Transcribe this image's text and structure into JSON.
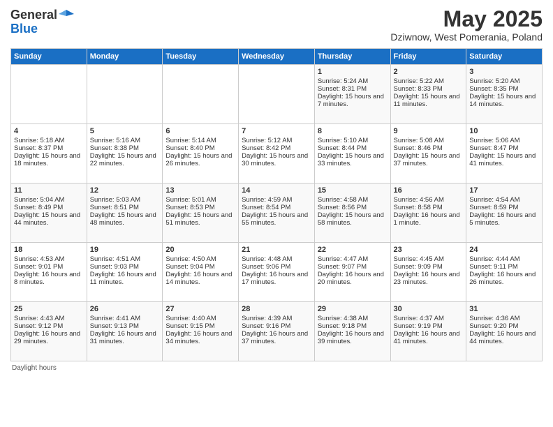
{
  "header": {
    "logo_general": "General",
    "logo_blue": "Blue",
    "month": "May 2025",
    "location": "Dziwnow, West Pomerania, Poland"
  },
  "days_of_week": [
    "Sunday",
    "Monday",
    "Tuesday",
    "Wednesday",
    "Thursday",
    "Friday",
    "Saturday"
  ],
  "footer": "Daylight hours",
  "weeks": [
    [
      {
        "day": "",
        "sunrise": "",
        "sunset": "",
        "daylight": "",
        "empty": true
      },
      {
        "day": "",
        "sunrise": "",
        "sunset": "",
        "daylight": "",
        "empty": true
      },
      {
        "day": "",
        "sunrise": "",
        "sunset": "",
        "daylight": "",
        "empty": true
      },
      {
        "day": "",
        "sunrise": "",
        "sunset": "",
        "daylight": "",
        "empty": true
      },
      {
        "day": "1",
        "sunrise": "Sunrise: 5:24 AM",
        "sunset": "Sunset: 8:31 PM",
        "daylight": "Daylight: 15 hours and 7 minutes."
      },
      {
        "day": "2",
        "sunrise": "Sunrise: 5:22 AM",
        "sunset": "Sunset: 8:33 PM",
        "daylight": "Daylight: 15 hours and 11 minutes."
      },
      {
        "day": "3",
        "sunrise": "Sunrise: 5:20 AM",
        "sunset": "Sunset: 8:35 PM",
        "daylight": "Daylight: 15 hours and 14 minutes."
      }
    ],
    [
      {
        "day": "4",
        "sunrise": "Sunrise: 5:18 AM",
        "sunset": "Sunset: 8:37 PM",
        "daylight": "Daylight: 15 hours and 18 minutes."
      },
      {
        "day": "5",
        "sunrise": "Sunrise: 5:16 AM",
        "sunset": "Sunset: 8:38 PM",
        "daylight": "Daylight: 15 hours and 22 minutes."
      },
      {
        "day": "6",
        "sunrise": "Sunrise: 5:14 AM",
        "sunset": "Sunset: 8:40 PM",
        "daylight": "Daylight: 15 hours and 26 minutes."
      },
      {
        "day": "7",
        "sunrise": "Sunrise: 5:12 AM",
        "sunset": "Sunset: 8:42 PM",
        "daylight": "Daylight: 15 hours and 30 minutes."
      },
      {
        "day": "8",
        "sunrise": "Sunrise: 5:10 AM",
        "sunset": "Sunset: 8:44 PM",
        "daylight": "Daylight: 15 hours and 33 minutes."
      },
      {
        "day": "9",
        "sunrise": "Sunrise: 5:08 AM",
        "sunset": "Sunset: 8:46 PM",
        "daylight": "Daylight: 15 hours and 37 minutes."
      },
      {
        "day": "10",
        "sunrise": "Sunrise: 5:06 AM",
        "sunset": "Sunset: 8:47 PM",
        "daylight": "Daylight: 15 hours and 41 minutes."
      }
    ],
    [
      {
        "day": "11",
        "sunrise": "Sunrise: 5:04 AM",
        "sunset": "Sunset: 8:49 PM",
        "daylight": "Daylight: 15 hours and 44 minutes."
      },
      {
        "day": "12",
        "sunrise": "Sunrise: 5:03 AM",
        "sunset": "Sunset: 8:51 PM",
        "daylight": "Daylight: 15 hours and 48 minutes."
      },
      {
        "day": "13",
        "sunrise": "Sunrise: 5:01 AM",
        "sunset": "Sunset: 8:53 PM",
        "daylight": "Daylight: 15 hours and 51 minutes."
      },
      {
        "day": "14",
        "sunrise": "Sunrise: 4:59 AM",
        "sunset": "Sunset: 8:54 PM",
        "daylight": "Daylight: 15 hours and 55 minutes."
      },
      {
        "day": "15",
        "sunrise": "Sunrise: 4:58 AM",
        "sunset": "Sunset: 8:56 PM",
        "daylight": "Daylight: 15 hours and 58 minutes."
      },
      {
        "day": "16",
        "sunrise": "Sunrise: 4:56 AM",
        "sunset": "Sunset: 8:58 PM",
        "daylight": "Daylight: 16 hours and 1 minute."
      },
      {
        "day": "17",
        "sunrise": "Sunrise: 4:54 AM",
        "sunset": "Sunset: 8:59 PM",
        "daylight": "Daylight: 16 hours and 5 minutes."
      }
    ],
    [
      {
        "day": "18",
        "sunrise": "Sunrise: 4:53 AM",
        "sunset": "Sunset: 9:01 PM",
        "daylight": "Daylight: 16 hours and 8 minutes."
      },
      {
        "day": "19",
        "sunrise": "Sunrise: 4:51 AM",
        "sunset": "Sunset: 9:03 PM",
        "daylight": "Daylight: 16 hours and 11 minutes."
      },
      {
        "day": "20",
        "sunrise": "Sunrise: 4:50 AM",
        "sunset": "Sunset: 9:04 PM",
        "daylight": "Daylight: 16 hours and 14 minutes."
      },
      {
        "day": "21",
        "sunrise": "Sunrise: 4:48 AM",
        "sunset": "Sunset: 9:06 PM",
        "daylight": "Daylight: 16 hours and 17 minutes."
      },
      {
        "day": "22",
        "sunrise": "Sunrise: 4:47 AM",
        "sunset": "Sunset: 9:07 PM",
        "daylight": "Daylight: 16 hours and 20 minutes."
      },
      {
        "day": "23",
        "sunrise": "Sunrise: 4:45 AM",
        "sunset": "Sunset: 9:09 PM",
        "daylight": "Daylight: 16 hours and 23 minutes."
      },
      {
        "day": "24",
        "sunrise": "Sunrise: 4:44 AM",
        "sunset": "Sunset: 9:11 PM",
        "daylight": "Daylight: 16 hours and 26 minutes."
      }
    ],
    [
      {
        "day": "25",
        "sunrise": "Sunrise: 4:43 AM",
        "sunset": "Sunset: 9:12 PM",
        "daylight": "Daylight: 16 hours and 29 minutes."
      },
      {
        "day": "26",
        "sunrise": "Sunrise: 4:41 AM",
        "sunset": "Sunset: 9:13 PM",
        "daylight": "Daylight: 16 hours and 31 minutes."
      },
      {
        "day": "27",
        "sunrise": "Sunrise: 4:40 AM",
        "sunset": "Sunset: 9:15 PM",
        "daylight": "Daylight: 16 hours and 34 minutes."
      },
      {
        "day": "28",
        "sunrise": "Sunrise: 4:39 AM",
        "sunset": "Sunset: 9:16 PM",
        "daylight": "Daylight: 16 hours and 37 minutes."
      },
      {
        "day": "29",
        "sunrise": "Sunrise: 4:38 AM",
        "sunset": "Sunset: 9:18 PM",
        "daylight": "Daylight: 16 hours and 39 minutes."
      },
      {
        "day": "30",
        "sunrise": "Sunrise: 4:37 AM",
        "sunset": "Sunset: 9:19 PM",
        "daylight": "Daylight: 16 hours and 41 minutes."
      },
      {
        "day": "31",
        "sunrise": "Sunrise: 4:36 AM",
        "sunset": "Sunset: 9:20 PM",
        "daylight": "Daylight: 16 hours and 44 minutes."
      }
    ]
  ]
}
